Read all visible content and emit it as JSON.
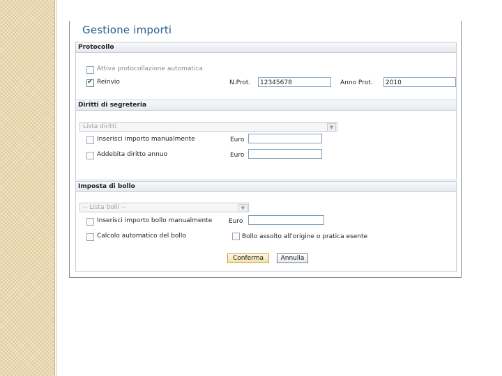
{
  "page": {
    "title": "Gestione importi"
  },
  "protocollo": {
    "header": "Protocollo",
    "auto_label": "Attiva protocollazione automatica",
    "auto_checked": false,
    "reinvio_label": "Reinvio",
    "reinvio_checked": true,
    "nprot_label": "N.Prot.",
    "nprot_value": "12345678",
    "anno_label": "Anno Prot.",
    "anno_value": "2010"
  },
  "diritti": {
    "header": "Diritti di segreteria",
    "select_value": "Lista diritti",
    "manual_label": "Inserisci importo manualmente",
    "manual_checked": false,
    "manual_euro_label": "Euro",
    "annuo_label": "Addebita diritto annuo",
    "annuo_checked": false,
    "annuo_euro_label": "Euro"
  },
  "bollo": {
    "header": "Imposta di bollo",
    "select_value": "-- Lista bolli --",
    "manual_label": "Inserisci importo bollo manualmente",
    "manual_checked": false,
    "manual_euro_label": "Euro",
    "auto_label": "Calcolo automatico del bollo",
    "auto_checked": false,
    "esente_label": "Bollo assolto all'origine o pratica esente",
    "esente_checked": false
  },
  "actions": {
    "confirm_label": "Conferma",
    "cancel_label": "Annulla"
  }
}
